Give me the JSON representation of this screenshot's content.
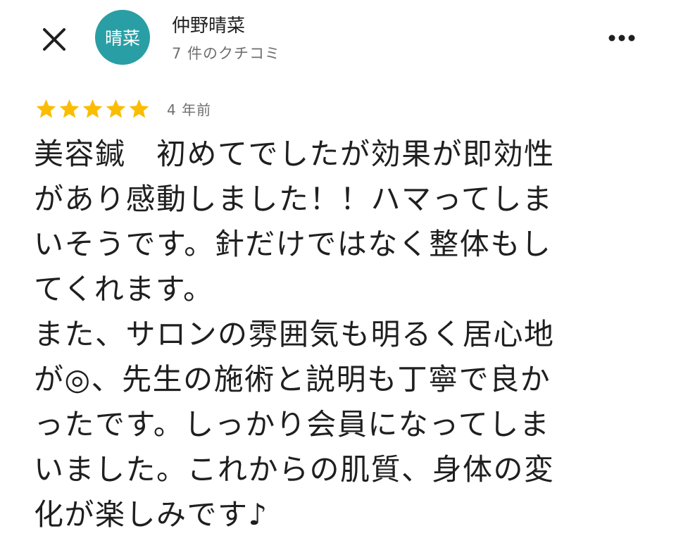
{
  "header": {
    "close_icon": "close-icon",
    "avatar_text": "晴菜",
    "avatar_color": "#2a9ea5",
    "user_name": "仲野晴菜",
    "review_count": "7 件のクチコミ",
    "more_icon": "more-horizontal-icon"
  },
  "review": {
    "rating": 5,
    "max_rating": 5,
    "star_color": "#fbbc04",
    "date": "4 年前",
    "lines": [
      "美容鍼　初めてでしたが効果が即効性",
      "があり感動しました！！ハマってしま",
      "いそうです。針だけではなく整体もし",
      "てくれます。",
      "また、サロンの雰囲気も明るく居心地",
      "が◎、先生の施術と説明も丁寧で良か",
      "ったです。しっかり会員になってしま",
      "いました。これからの肌質、身体の変",
      "化が楽しみです♪"
    ]
  }
}
